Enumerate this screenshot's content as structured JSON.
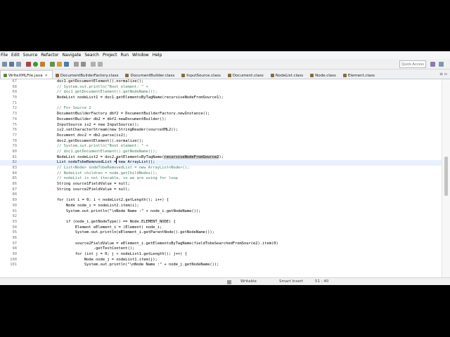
{
  "menu": [
    "File",
    "Edit",
    "Source",
    "Refactor",
    "Navigate",
    "Search",
    "Project",
    "Run",
    "Window",
    "Help"
  ],
  "toolbar": {
    "quick_access_placeholder": "Quick Access"
  },
  "tabs": [
    {
      "label": "WriteXMLFile.java",
      "active": true,
      "close": "✕"
    },
    {
      "label": "DocumentBuilderFactory.class",
      "active": false,
      "close": ""
    },
    {
      "label": "DocumentBuilder.class",
      "active": false,
      "close": ""
    },
    {
      "label": "InputSource.class",
      "active": false,
      "close": ""
    },
    {
      "label": "Document.class",
      "active": false,
      "close": ""
    },
    {
      "label": "NodeList.class",
      "active": false,
      "close": ""
    },
    {
      "label": "Node.class",
      "active": false,
      "close": ""
    },
    {
      "label": "Element.class",
      "active": false,
      "close": ""
    }
  ],
  "tab_controls": "≡ ▫",
  "code_lines": [
    {
      "num": "67",
      "text": "                doc1.getDocumentElement().normalize();",
      "comment": false
    },
    {
      "num": "68",
      "text": "                // System.out.println(\"Root element: \" +",
      "comment": true
    },
    {
      "num": "69",
      "text": "                // doc1.getDocumentElement().getNodeName());",
      "comment": true
    },
    {
      "num": "70",
      "text": "                NodeList nodeList1 = doc1.getElementsByTagName(recursiveNodeFromSource1);",
      "comment": false
    },
    {
      "num": "71",
      "text": "",
      "comment": false
    },
    {
      "num": "72",
      "text": "                // For Source 2",
      "comment": true
    },
    {
      "num": "73",
      "text": "                DocumentBuilderFactory dbf2 = DocumentBuilderFactory.newInstance();",
      "comment": false
    },
    {
      "num": "74",
      "text": "                DocumentBuilder db2 = dbf2.newDocumentBuilder();",
      "comment": false
    },
    {
      "num": "75",
      "text": "                InputSource is2 = new InputSource();",
      "comment": false
    },
    {
      "num": "76",
      "text": "                is2.setCharacterStream(new StringReader(sourceXML2));",
      "comment": false
    },
    {
      "num": "77",
      "text": "                Document doc2 = db2.parse(is2);",
      "comment": false
    },
    {
      "num": "78",
      "text": "                doc2.getDocumentElement().normalize();",
      "comment": false
    },
    {
      "num": "79",
      "text": "                // System.out.println(\"Root element: \" +",
      "comment": true
    },
    {
      "num": "80",
      "text": "                // doc1.getDocumentElement().getNodeName());",
      "comment": true
    },
    {
      "num": "81",
      "text": "                NodeList nodeList2 = doc2.getElementsByTagName(recursiveNodeFromSource2);",
      "comment": false
    },
    {
      "num": "82",
      "text": "                List nodeTobeRemovedList = new ArrayList();",
      "comment": false
    },
    {
      "num": "83",
      "text": "                // List<Node> nodeTobeRemovedList = new ArrayList<Node>();",
      "comment": true
    },
    {
      "num": "84",
      "text": "                // NodeList children = node.getChildNodes();",
      "comment": true
    },
    {
      "num": "85",
      "text": "                // nodeList is not iterable, so we are using for loop",
      "comment": true
    },
    {
      "num": "86",
      "text": "                String source1FieldValue = null;",
      "comment": false
    },
    {
      "num": "87",
      "text": "                String source2FieldValue = null;",
      "comment": false
    },
    {
      "num": "88",
      "text": "",
      "comment": false
    },
    {
      "num": "89",
      "text": "                for (int i = 0; i < nodeList2.getLength(); i++) {",
      "comment": false
    },
    {
      "num": "90",
      "text": "                    Node node_i = nodeList2.item(i);",
      "comment": false
    },
    {
      "num": "91",
      "text": "                    System.out.println(\"\\nNode Name :\" + node_i.getNodeName());",
      "comment": false
    },
    {
      "num": "92",
      "text": "",
      "comment": false
    },
    {
      "num": "93",
      "text": "                    if (node_i.getNodeType() == Node.ELEMENT_NODE) {",
      "comment": false
    },
    {
      "num": "94",
      "text": "                        Element eElement_i = (Element) node_i;",
      "comment": false
    },
    {
      "num": "95",
      "text": "                        System.out.println(eElement_i.getParentNode().getNodeName());",
      "comment": false
    },
    {
      "num": "96",
      "text": "",
      "comment": false
    },
    {
      "num": "97",
      "text": "                        source2FieldValue = eElement_i.getElementsByTagName(fieldTobeSearchedFromSource2).item(0)",
      "comment": false
    },
    {
      "num": "98",
      "text": "                                .getTextContent();",
      "comment": false
    },
    {
      "num": "99",
      "text": "                        for (int j = 0; j < nodeList1.getLength(); j++) {",
      "comment": false
    },
    {
      "num": "100",
      "text": "                            Node node_j = nodeList1.item(j);",
      "comment": false
    },
    {
      "num": "101",
      "text": "                            System.out.println(\"\\nNode Name :\" + node_j.getNodeName());",
      "comment": false
    }
  ],
  "status": {
    "writable": "Writable",
    "insert_mode": "Smart Insert",
    "position": "51 : 40"
  },
  "colors": {
    "comment": "#3f7f5f",
    "keyword": "#7f0055",
    "selection_highlight": "#d4d4d4",
    "current_line": "#e8f2fe"
  }
}
